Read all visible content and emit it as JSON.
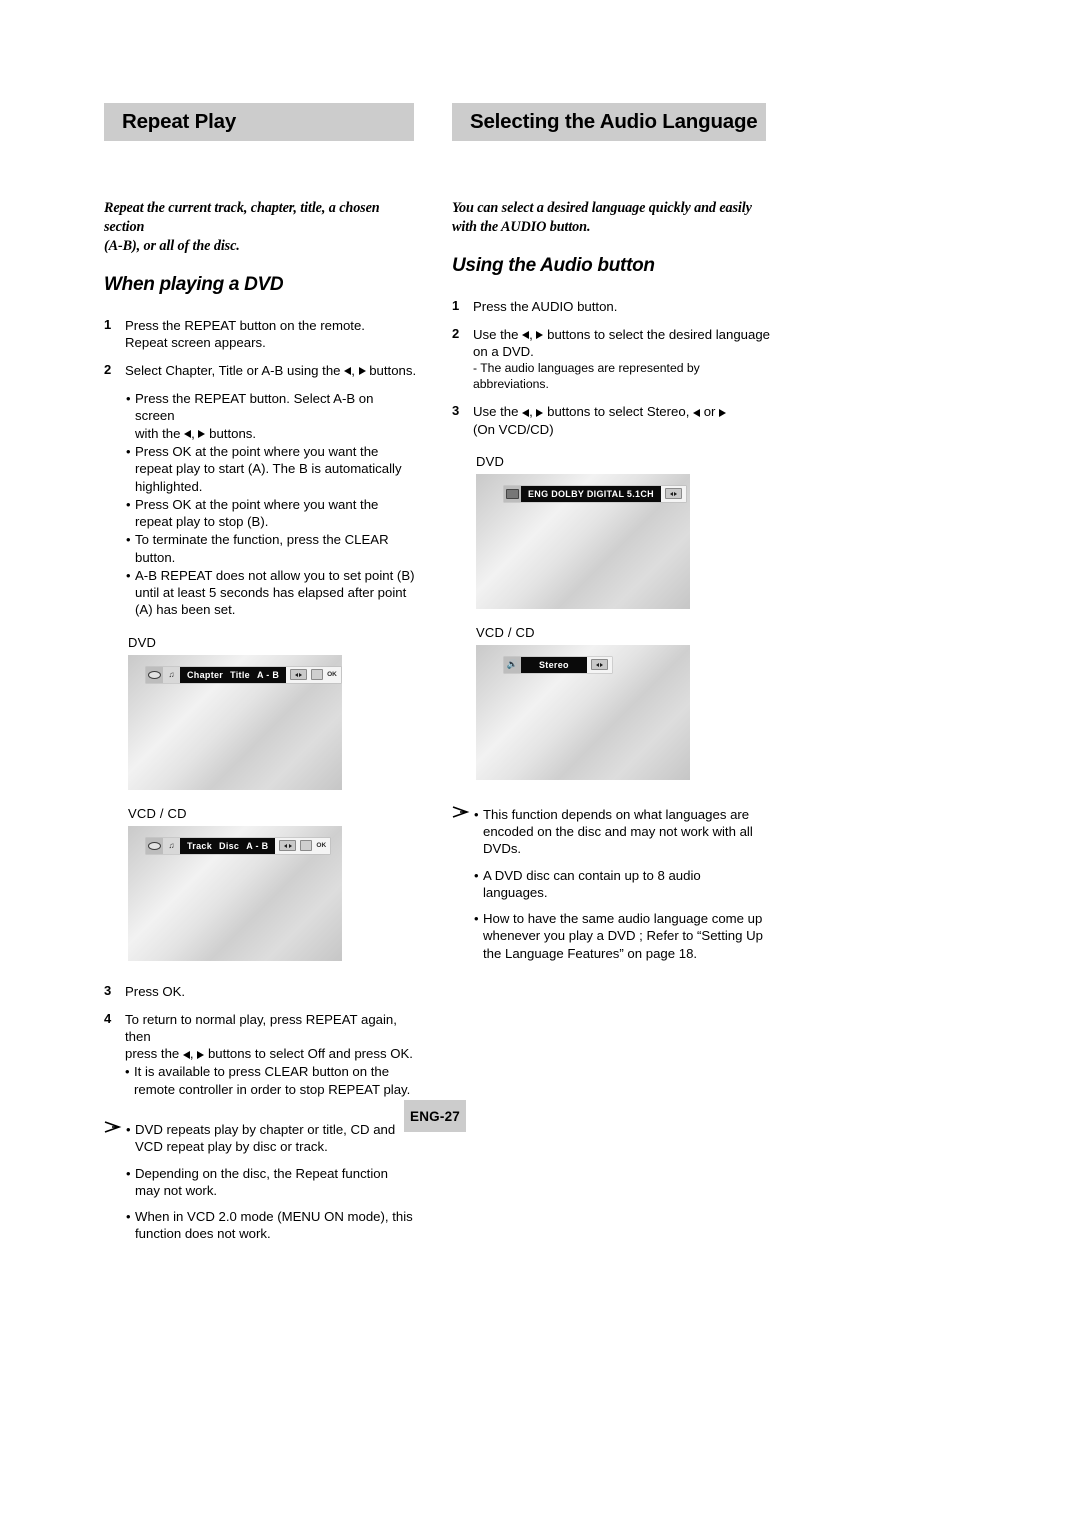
{
  "page": {
    "number_label": "ENG-27"
  },
  "left_column": {
    "section_title": "Repeat Play",
    "intro_line1": "Repeat the current track, chapter, title, a chosen section",
    "intro_line2": "(A-B), or all of the disc.",
    "subheading": "When playing a DVD",
    "steps": [
      {
        "num": "1",
        "line1": "Press the REPEAT button on the remote.",
        "line2": "Repeat screen appears."
      },
      {
        "num": "2",
        "line1": "Select Chapter, Title or A-B using the",
        "line1_tail": "buttons."
      }
    ],
    "step2_bullets": [
      "Press the REPEAT button. Select A-B on screen",
      "Press OK at the point where you want the repeat play to start (A). The B is automatically highlighted.",
      "Press OK at the point where you want the repeat play to stop (B).",
      "To terminate the function, press the CLEAR button.",
      "A-B REPEAT does not allow you to set point (B) until at least 5 seconds has elapsed after point (A) has been set."
    ],
    "bullet1_tail": "with the",
    "bullet1_tail2": "buttons.",
    "screens": [
      {
        "label": "DVD",
        "osd_items": [
          "Chapter",
          "Title",
          "A - B"
        ],
        "left_icons": [
          "disc-icon",
          "note-icon"
        ],
        "tail_keys": [
          "left-right-key",
          "ok-key"
        ],
        "ok_label": "OK"
      },
      {
        "label": "VCD / CD",
        "osd_items": [
          "Track",
          "Disc",
          "A - B"
        ],
        "left_icons": [
          "disc-icon",
          "note-icon"
        ],
        "tail_keys": [
          "left-right-key",
          "ok-key"
        ],
        "ok_label": "OK"
      }
    ],
    "steps_after": [
      {
        "num": "3",
        "line1": "Press OK."
      },
      {
        "num": "4",
        "line1": "To return to normal play, press REPEAT again, then",
        "line2_head": "press the",
        "line2_tail": "buttons to select Off and press OK."
      }
    ],
    "step4_bullets": [
      "It is available to press CLEAR button on the remote controller in order to stop REPEAT play."
    ],
    "notes": [
      "DVD repeats play by chapter or title, CD and VCD repeat play by disc or track.",
      "Depending on the disc, the Repeat function may not work.",
      "When in VCD 2.0 mode (MENU ON mode), this function does not work."
    ]
  },
  "right_column": {
    "section_title": "Selecting the Audio Language",
    "intro_line1": "You can select a desired language quickly and easily",
    "intro_line2": "with the AUDIO button.",
    "subheading": "Using the Audio button",
    "steps": [
      {
        "num": "1",
        "line1": "Press the AUDIO button."
      },
      {
        "num": "2",
        "line1_head": "Use the",
        "line1_tail": "buttons to select the desired language",
        "line2": "on a DVD.",
        "line3": "- The audio languages are represented by abbreviations."
      },
      {
        "num": "3",
        "line1_head": "Use the",
        "line1_mid": "buttons to select Stereo,",
        "line1_or": "or",
        "line2": "(On VCD/CD)"
      }
    ],
    "screens": [
      {
        "label": "DVD",
        "osd_text": "ENG  DOLBY DIGITAL  5.1CH",
        "left_icon": "film-icon",
        "tail_keys": [
          "left-right-key"
        ]
      },
      {
        "label": "VCD / CD",
        "osd_text": "Stereo",
        "left_icon": "speaker-icon",
        "tail_keys": [
          "left-right-key"
        ]
      }
    ],
    "notes": [
      "This function depends on what languages are encoded on the disc and may not work with all DVDs.",
      "A DVD disc can contain up to 8 audio languages.",
      "How to have the same audio language come up whenever you play a  DVD ;  Refer to “Setting Up the Language Features” on page 18."
    ]
  },
  "colors": {
    "bar_gray": "#cccccc",
    "osd_black": "#0a0a0a",
    "text": "#000000"
  }
}
